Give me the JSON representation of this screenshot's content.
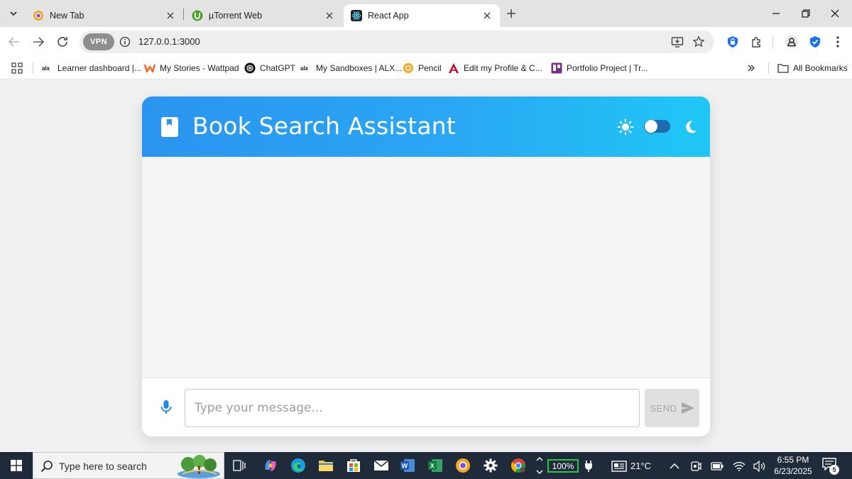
{
  "browser": {
    "tabs": [
      {
        "title": "New Tab",
        "icon": "chrome-new-tab-icon",
        "active": false
      },
      {
        "title": "µTorrent Web",
        "icon": "utorrent-icon",
        "active": false
      },
      {
        "title": "React App",
        "icon": "react-icon",
        "active": true
      }
    ],
    "address": {
      "vpn_label": "VPN",
      "url": "127.0.0.1:3000"
    },
    "bookmarks": [
      {
        "label": "Learner dashboard |...",
        "icon": "alx-icon"
      },
      {
        "label": "My Stories - Wattpad",
        "icon": "wattpad-icon"
      },
      {
        "label": "ChatGPT",
        "icon": "chatgpt-icon"
      },
      {
        "label": "My Sandboxes | ALX...",
        "icon": "alx-icon"
      },
      {
        "label": "Pencil",
        "icon": "pencil-app-icon"
      },
      {
        "label": "Edit my Profile & C...",
        "icon": "angular-icon"
      },
      {
        "label": "Portfolio Project | Tr...",
        "icon": "trello-icon"
      }
    ],
    "all_bookmarks": "All Bookmarks"
  },
  "app": {
    "title": "Book Search Assistant",
    "theme_toggle": {
      "mode": "light",
      "light_icon": "sun-icon",
      "dark_icon": "moon-icon"
    },
    "input_placeholder": "Type your message...",
    "input_value": "",
    "send_label": "SEND"
  },
  "taskbar": {
    "search_placeholder": "Type here to search",
    "battery": "100%",
    "temperature": "21°C",
    "time": "6:55 PM",
    "date": "6/23/2025",
    "notification_count": "5"
  },
  "colors": {
    "header_gradient_start": "#2b94f0",
    "header_gradient_end": "#1fc7f5",
    "toggle_track": "#1e6bb0",
    "send_disabled": "#e0e0e0",
    "taskbar": "#1f2b3a"
  }
}
